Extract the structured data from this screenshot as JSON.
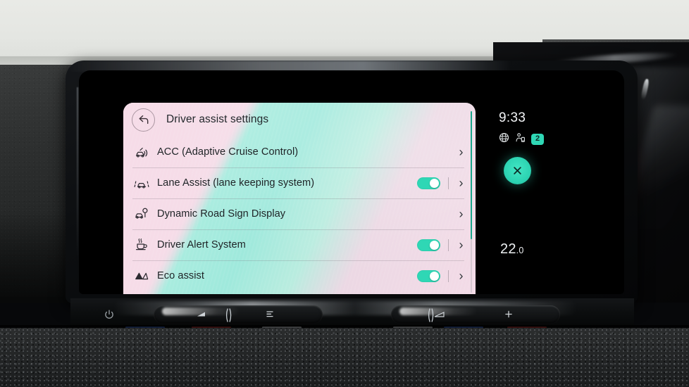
{
  "device": {
    "type": "car-infotainment-touchscreen",
    "accent_teal": "#2fd7b5",
    "panel_pink": "#f3d9e6",
    "panel_teal": "#a9ecdf"
  },
  "screen": {
    "header": {
      "back_icon": "back-arrow-icon",
      "title": "Driver assist settings"
    },
    "rows": [
      {
        "icon": "adaptive-cruise-control-icon",
        "label": "ACC (Adaptive Cruise Control)",
        "has_toggle": false,
        "toggle_on": false,
        "chevron": "›"
      },
      {
        "icon": "lane-assist-icon",
        "label": "Lane Assist (lane keeping system)",
        "has_toggle": true,
        "toggle_on": true,
        "chevron": "›"
      },
      {
        "icon": "road-sign-display-icon",
        "label": "Dynamic Road Sign Display",
        "has_toggle": false,
        "toggle_on": false,
        "chevron": "›"
      },
      {
        "icon": "coffee-cup-icon",
        "label": "Driver Alert System",
        "has_toggle": true,
        "toggle_on": true,
        "chevron": "›"
      },
      {
        "icon": "eco-assist-icon",
        "label": "Eco assist",
        "has_toggle": true,
        "toggle_on": true,
        "chevron": "›"
      }
    ],
    "status": {
      "clock": "9:33",
      "globe_icon": "globe-icon",
      "phone_user_icon": "phone-user-icon",
      "badge_count": "2",
      "close_icon": "close-x-icon",
      "temperature_whole": "22",
      "temperature_decimal": ".0"
    }
  },
  "controls": {
    "power_icon": "power-icon",
    "left_slider": "volume-slider",
    "right_slider": "temperature-slider"
  }
}
